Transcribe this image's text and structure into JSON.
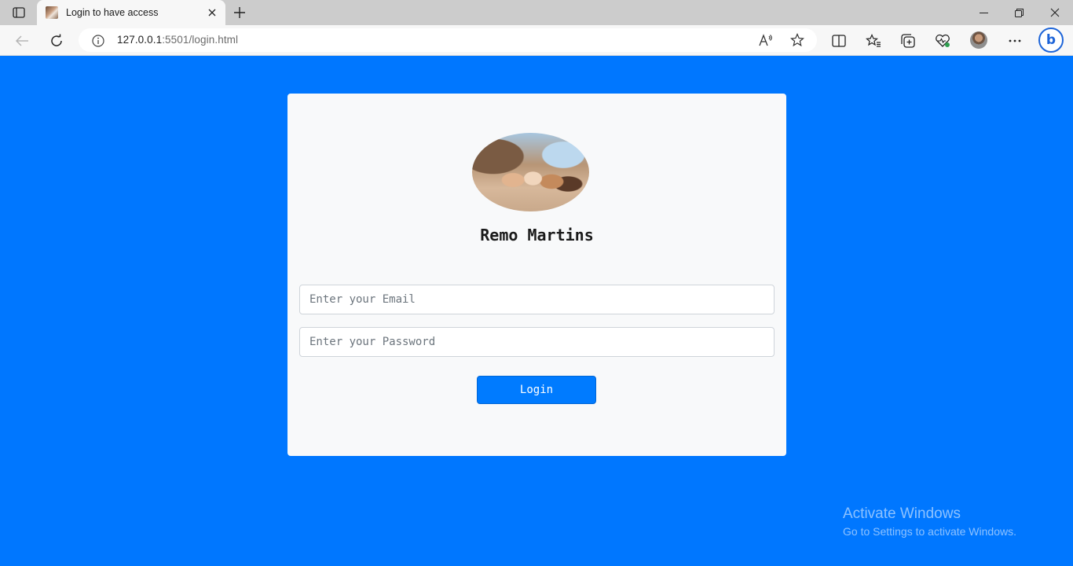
{
  "browser": {
    "tab": {
      "title": "Login to have access"
    },
    "address": {
      "host": "127.0.0.1",
      "path": ":5501/login.html"
    },
    "icons": {
      "tab_actions": "tab-actions-icon",
      "close": "close-icon",
      "new_tab": "plus-icon",
      "minimize": "minimize-icon",
      "restore": "restore-icon",
      "close_window": "close-window-icon",
      "back": "back-arrow-icon",
      "refresh": "refresh-icon",
      "info": "info-icon",
      "read_aloud": "read-aloud-icon",
      "favorite": "star-icon",
      "split_screen": "split-screen-icon",
      "favorites": "favorites-icon",
      "collections": "collections-icon",
      "browser_essentials": "heart-pulse-icon",
      "profile": "profile-avatar",
      "more": "more-icon",
      "copilot": "copilot-icon"
    }
  },
  "login": {
    "name": "Remo Martins",
    "email_placeholder": "Enter your Email",
    "password_placeholder": "Enter your Password",
    "button_label": "Login"
  },
  "watermark": {
    "title": "Activate Windows",
    "subtitle": "Go to Settings to activate Windows."
  },
  "colors": {
    "page_background": "#0077ff",
    "card_background": "#f8f9fa",
    "button": "#007bff"
  }
}
